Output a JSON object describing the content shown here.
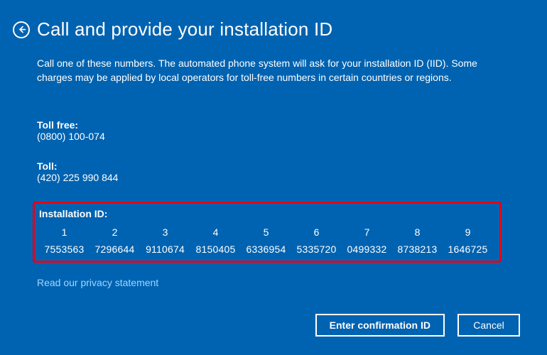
{
  "header": {
    "title": "Call and provide your installation ID"
  },
  "description": "Call one of these numbers. The automated phone system will ask for your installation ID (IID). Some charges may be applied by local operators for toll-free numbers in certain countries or regions.",
  "phone": {
    "toll_free_label": "Toll free:",
    "toll_free_number": "(0800) 100-074",
    "toll_label": "Toll:",
    "toll_number": "(420) 225 990 844"
  },
  "installation_id": {
    "label": "Installation ID:",
    "groups": [
      {
        "index": "1",
        "value": "7553563"
      },
      {
        "index": "2",
        "value": "7296644"
      },
      {
        "index": "3",
        "value": "9110674"
      },
      {
        "index": "4",
        "value": "8150405"
      },
      {
        "index": "5",
        "value": "6336954"
      },
      {
        "index": "6",
        "value": "5335720"
      },
      {
        "index": "7",
        "value": "0499332"
      },
      {
        "index": "8",
        "value": "8738213"
      },
      {
        "index": "9",
        "value": "1646725"
      }
    ]
  },
  "links": {
    "privacy": "Read our privacy statement"
  },
  "buttons": {
    "enter_confirmation": "Enter confirmation ID",
    "cancel": "Cancel"
  }
}
